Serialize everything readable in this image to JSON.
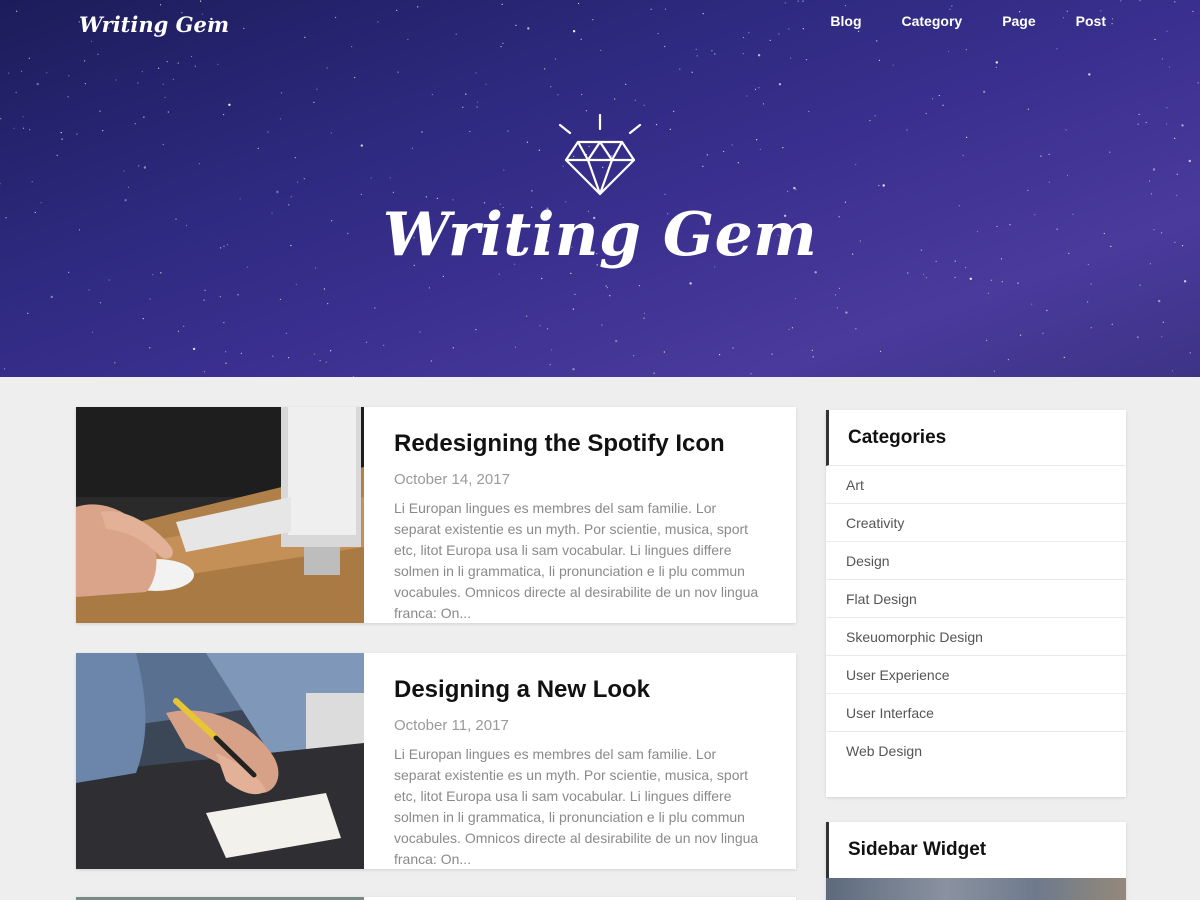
{
  "site": {
    "brand": "Writing Gem",
    "hero_title": "Writing Gem"
  },
  "nav": {
    "items": [
      "Blog",
      "Category",
      "Page",
      "Post"
    ]
  },
  "posts": [
    {
      "title": "Redesigning the Spotify Icon",
      "date": "October 14, 2017",
      "excerpt": "Li Europan lingues es membres del sam familie. Lor separat existentie es un myth. Por scientie, musica, sport etc, litot Europa usa li sam vocabular. Li lingues differe solmen in li grammatica, li pronunciation e li plu commun vocabules. Omnicos directe al desirabilite de un nov lingua franca: On..."
    },
    {
      "title": "Designing a New Look",
      "date": "October 11, 2017",
      "excerpt": "Li Europan lingues es membres del sam familie. Lor separat existentie es un myth. Por scientie, musica, sport etc, litot Europa usa li sam vocabular. Li lingues differe solmen in li grammatica, li pronunciation e li plu commun vocabules. Omnicos directe al desirabilite de un nov lingua franca: On..."
    }
  ],
  "sidebar": {
    "categories_title": "Categories",
    "categories": [
      "Art",
      "Creativity",
      "Design",
      "Flat Design",
      "Skeuomorphic Design",
      "User Experience",
      "User Interface",
      "Web Design"
    ],
    "widget_title": "Sidebar Widget"
  },
  "colors": {
    "hero_bg": "#2e2a80",
    "page_bg": "#eeeeee",
    "accent_border": "#333333"
  },
  "icons": {
    "logo": "diamond-icon"
  }
}
